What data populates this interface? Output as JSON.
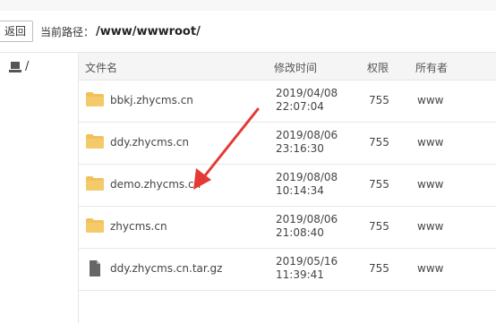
{
  "pathbar": {
    "back_label": "返回",
    "path_label": "当前路径：",
    "path_value": "/www/wwwroot/"
  },
  "sidebar": {
    "drive_label": "/"
  },
  "table": {
    "headers": {
      "name": "文件名",
      "time": "修改时间",
      "perm": "权限",
      "owner": "所有者"
    },
    "rows": [
      {
        "type": "folder",
        "name": "bbkj.zhycms.cn",
        "date": "2019/04/08",
        "time": "22:07:04",
        "perm": "755",
        "owner": "www"
      },
      {
        "type": "folder",
        "name": "ddy.zhycms.cn",
        "date": "2019/08/06",
        "time": "23:16:30",
        "perm": "755",
        "owner": "www"
      },
      {
        "type": "folder",
        "name": "demo.zhycms.cn",
        "date": "2019/08/08",
        "time": "10:14:34",
        "perm": "755",
        "owner": "www"
      },
      {
        "type": "folder",
        "name": "zhycms.cn",
        "date": "2019/08/06",
        "time": "21:08:40",
        "perm": "755",
        "owner": "www"
      },
      {
        "type": "file",
        "name": "ddy.zhycms.cn.tar.gz",
        "date": "2019/05/16",
        "time": "11:39:41",
        "perm": "755",
        "owner": "www"
      }
    ]
  },
  "icons": {
    "folder": "folder-icon",
    "file": "file-icon",
    "drive": "drive-icon"
  },
  "colors": {
    "folder": "#f2c15a",
    "annotation_arrow": "#e53935"
  }
}
